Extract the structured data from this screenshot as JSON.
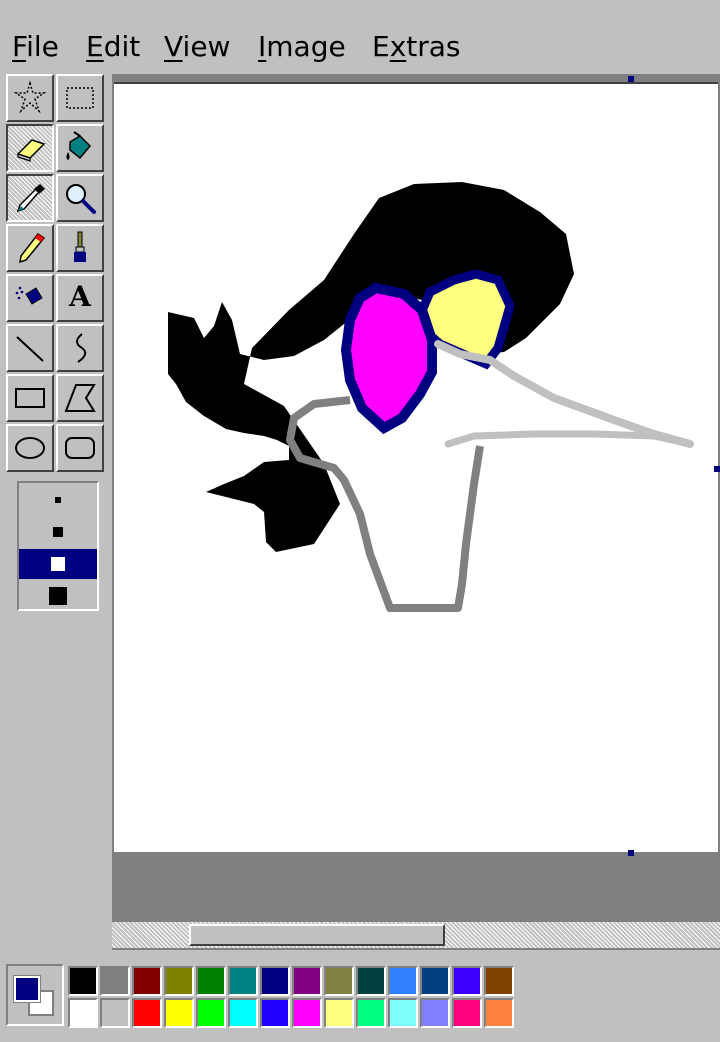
{
  "menu": [
    {
      "pre": "",
      "acc": "F",
      "post": "ile"
    },
    {
      "pre": "",
      "acc": "E",
      "post": "dit"
    },
    {
      "pre": "",
      "acc": "V",
      "post": "iew"
    },
    {
      "pre": "",
      "acc": "I",
      "post": "mage"
    },
    {
      "pre": "E",
      "acc": "x",
      "post": "tras"
    }
  ],
  "tools": [
    {
      "name": "free-select-tool",
      "icon": "star-select-icon",
      "pressed": false
    },
    {
      "name": "rect-select-tool",
      "icon": "dotted-rect-icon",
      "pressed": false
    },
    {
      "name": "eraser-tool",
      "icon": "eraser-icon",
      "pressed": true
    },
    {
      "name": "fill-tool",
      "icon": "paint-bucket-icon",
      "pressed": false
    },
    {
      "name": "color-picker-tool",
      "icon": "eyedropper-icon",
      "pressed": true
    },
    {
      "name": "magnifier-tool",
      "icon": "magnifier-icon",
      "pressed": false
    },
    {
      "name": "pencil-tool",
      "icon": "pencil-icon",
      "pressed": false
    },
    {
      "name": "brush-tool",
      "icon": "brush-icon",
      "pressed": false
    },
    {
      "name": "airbrush-tool",
      "icon": "airbrush-icon",
      "pressed": false
    },
    {
      "name": "text-tool",
      "icon": "text-a-icon",
      "pressed": false
    },
    {
      "name": "line-tool",
      "icon": "line-icon",
      "pressed": false
    },
    {
      "name": "curve-tool",
      "icon": "curve-icon",
      "pressed": false
    },
    {
      "name": "rectangle-tool",
      "icon": "rectangle-icon",
      "pressed": false
    },
    {
      "name": "polygon-tool",
      "icon": "polygon-icon",
      "pressed": false
    },
    {
      "name": "ellipse-tool",
      "icon": "ellipse-icon",
      "pressed": false
    },
    {
      "name": "rounded-rect-tool",
      "icon": "rounded-rect-icon",
      "pressed": false
    }
  ],
  "text_tool_glyph": "A",
  "brush_sizes": {
    "selected_index": 2,
    "count": 4
  },
  "current_colors": {
    "foreground": "#000080",
    "background": "#ffffff"
  },
  "palette": {
    "top": [
      "#000000",
      "#808080",
      "#800000",
      "#808000",
      "#008000",
      "#008080",
      "#000080",
      "#800080",
      "#808040",
      "#004040",
      "#3080ff",
      "#004080",
      "#4000ff",
      "#804000"
    ],
    "bottom": [
      "#ffffff",
      "#c0c0c0",
      "#ff0000",
      "#ffff00",
      "#00ff00",
      "#00ffff",
      "#2000ff",
      "#ff00ff",
      "#ffff80",
      "#00ff80",
      "#80ffff",
      "#8080ff",
      "#ff0080",
      "#ff8040"
    ]
  },
  "drawing_colors": {
    "hair": "#000000",
    "eye_left": "#ff00ff",
    "eye_right": "#ffff80",
    "eye_outline": "#000080",
    "beak_outline": "#808080",
    "beak_light": "#c0c0c0"
  },
  "scrollbar": {
    "position": 0.15
  }
}
